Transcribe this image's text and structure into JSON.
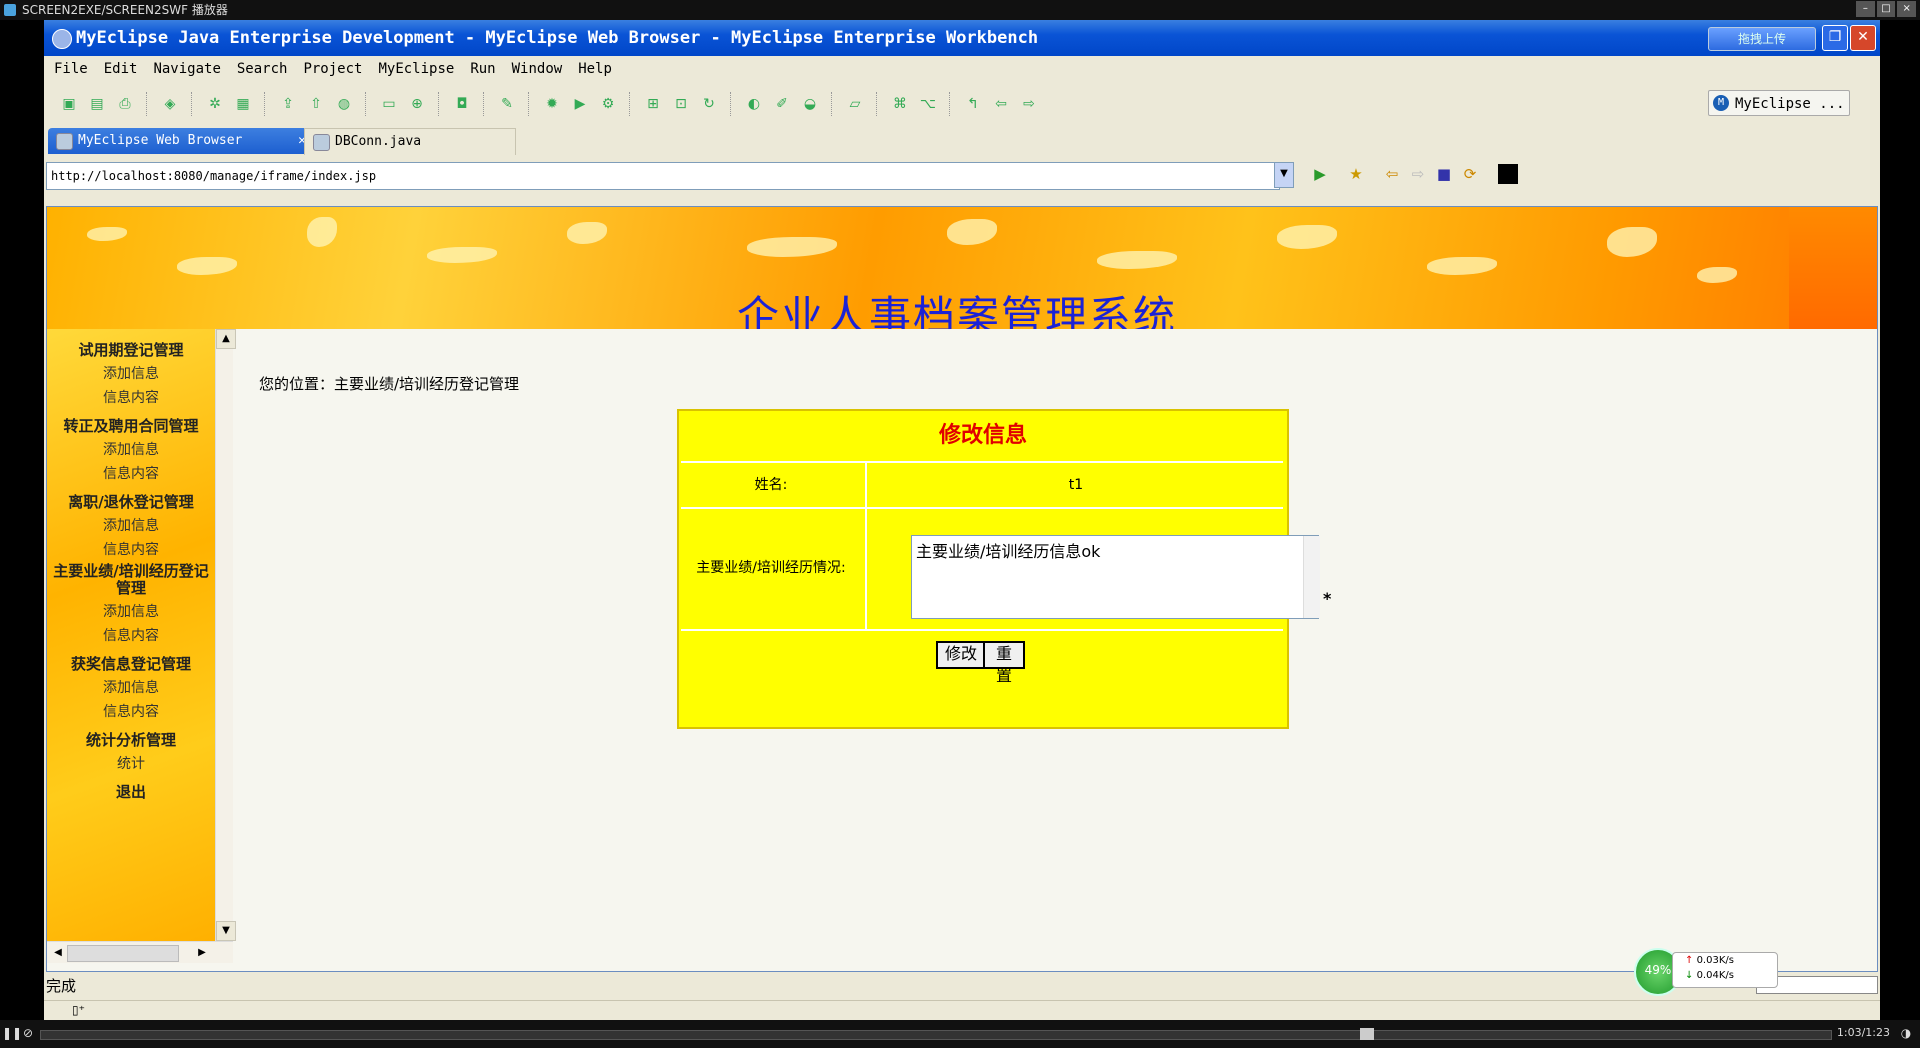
{
  "player": {
    "title": "SCREEN2EXE/SCREEN2SWF 播放器",
    "time": "1:03/1:23"
  },
  "window": {
    "title": "MyEclipse Java Enterprise Development - MyEclipse Web Browser - MyEclipse Enterprise Workbench",
    "upload_label": "拖拽上传"
  },
  "menu": [
    "File",
    "Edit",
    "Navigate",
    "Search",
    "Project",
    "MyEclipse",
    "Run",
    "Window",
    "Help"
  ],
  "perspective": "MyEclipse ...",
  "tabs": [
    {
      "label": "MyEclipse Web Browser",
      "active": true
    },
    {
      "label": "DBConn.java",
      "active": false
    }
  ],
  "url": "http://localhost:8080/manage/iframe/index.jsp",
  "page": {
    "banner_title": "企业人事档案管理系统",
    "breadcrumb": "您的位置：主要业绩/培训经历登记管理",
    "sidebar": [
      {
        "head": "试用期登记管理",
        "items": [
          "添加信息",
          "信息内容"
        ]
      },
      {
        "head": "转正及聘用合同管理",
        "items": [
          "添加信息",
          "信息内容"
        ]
      },
      {
        "head": "离职/退休登记管理",
        "items": [
          "添加信息",
          "信息内容"
        ]
      },
      {
        "head": "主要业绩/培训经历登记管理",
        "items": [
          "添加信息",
          "信息内容"
        ]
      },
      {
        "head": "获奖信息登记管理",
        "items": [
          "添加信息",
          "信息内容"
        ]
      },
      {
        "head": "统计分析管理",
        "items": [
          "统计"
        ]
      },
      {
        "head": "退出",
        "items": []
      }
    ],
    "form": {
      "title": "修改信息",
      "name_label": "姓名:",
      "name_value": "t1",
      "record_label": "主要业绩/培训经历情况:",
      "record_value": "主要业绩/培训经历信息ok",
      "required_mark": "*",
      "submit_label": "修改",
      "reset_label": "重置"
    }
  },
  "status": "完成",
  "network": {
    "percent": "49%",
    "up": "0.03K/s",
    "down": "0.04K/s"
  },
  "colors": {
    "banner_title": "#1b22d6",
    "form_bg": "#ffff00",
    "form_title": "#e00000",
    "titlebar": "#0a54d6"
  }
}
